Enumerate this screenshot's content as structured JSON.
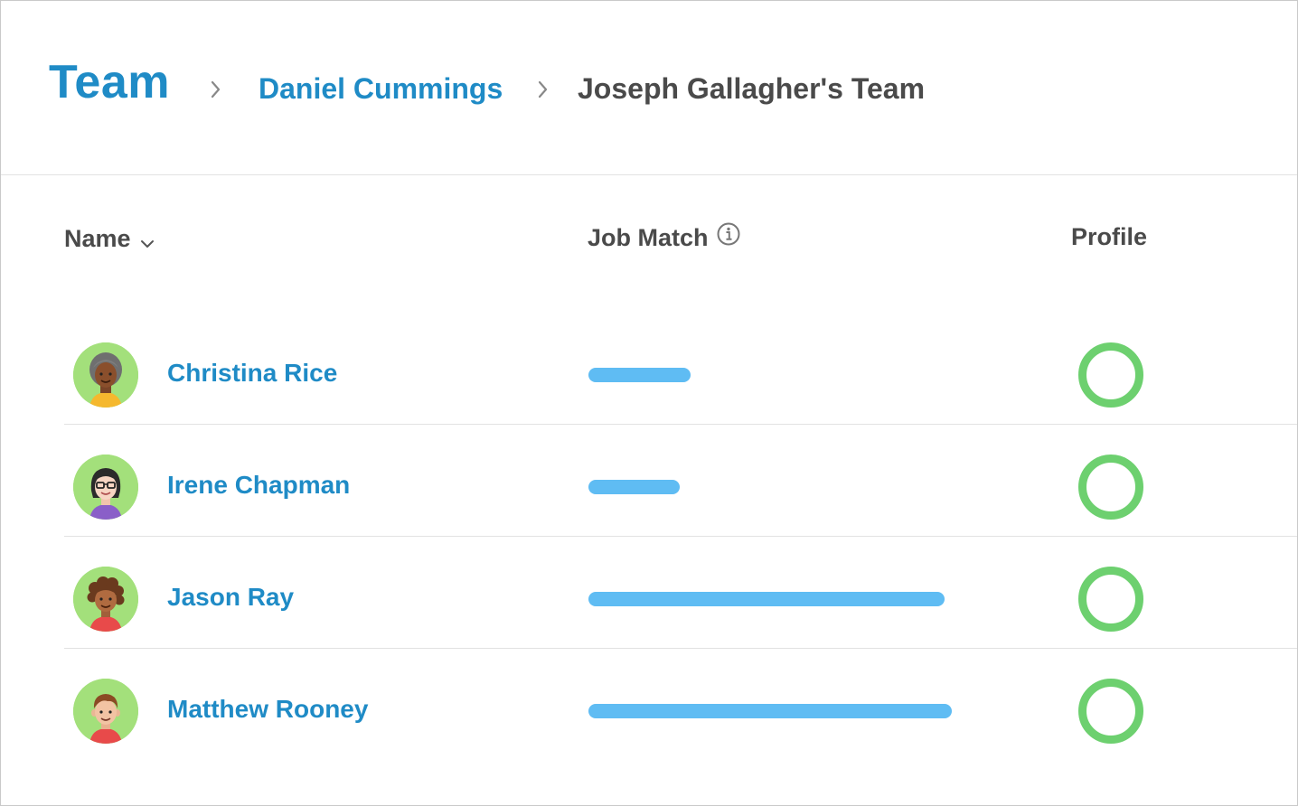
{
  "breadcrumb": {
    "root": "Team",
    "parent": "Daniel Cummings",
    "current": "Joseph Gallagher's Team"
  },
  "columns": {
    "name": "Name",
    "job_match": "Job Match",
    "profile": "Profile"
  },
  "colors": {
    "link": "#1f8bc6",
    "bar": "#5fbcf3",
    "profile_ring": "#6dd06f",
    "avatar_bg": "#a3e07b"
  },
  "members": [
    {
      "name": "Christina Rice",
      "job_match": 0.28,
      "avatar": "woman-gray-hair-avatar"
    },
    {
      "name": "Irene Chapman",
      "job_match": 0.25,
      "avatar": "woman-glasses-avatar"
    },
    {
      "name": "Jason Ray",
      "job_match": 0.98,
      "avatar": "man-curly-hair-avatar"
    },
    {
      "name": "Matthew Rooney",
      "job_match": 1.0,
      "avatar": "man-short-hair-avatar"
    }
  ]
}
